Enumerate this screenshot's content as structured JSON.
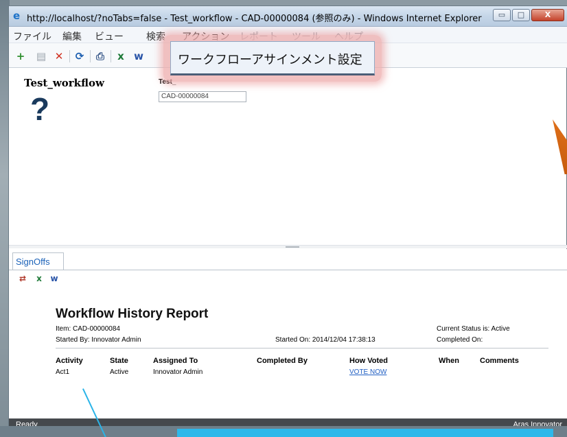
{
  "window": {
    "title": "http://localhost/?noTabs=false - Test_workflow - CAD-00000084 (参照のみ) - Windows Internet Explorer",
    "minimize": "▭",
    "maximize": "□",
    "close": "X"
  },
  "menu": {
    "items": [
      "ファイル",
      "編集",
      "ビュー",
      "検索",
      "アクション",
      "レポート",
      "ツール",
      "ヘルプ"
    ]
  },
  "popup": {
    "label": "ワークフローアサインメント設定"
  },
  "form": {
    "title": "Test_workflow",
    "field_label": "Test_",
    "field_value": "CAD-00000084",
    "image_placeholder": "?"
  },
  "signoffs": {
    "tab_label": "SignOffs"
  },
  "report": {
    "title": "Workflow History Report",
    "item": "Item: CAD-00000084",
    "started_by": "Started By: Innovator Admin",
    "started_on": "Started On: 2014/12/04 17:38:13",
    "current_status": "Current Status is: Active",
    "completed_on": "Completed On:",
    "columns": [
      "Activity",
      "State",
      "Assigned To",
      "Completed By",
      "How Voted",
      "When",
      "Comments"
    ],
    "rows": [
      {
        "activity": "Act1",
        "state": "Active",
        "assigned_to": "Innovator Admin",
        "completed_by": "",
        "how_voted": "VOTE NOW",
        "when": "",
        "comments": ""
      }
    ]
  },
  "status": {
    "left": "Ready",
    "right": "Aras Innovator"
  },
  "colors": {
    "link": "#2260c4",
    "tab_text": "#1b62b8",
    "status_bar": "#45494d",
    "popup_glow": "#eeacac",
    "callout": "#2db8ea"
  }
}
